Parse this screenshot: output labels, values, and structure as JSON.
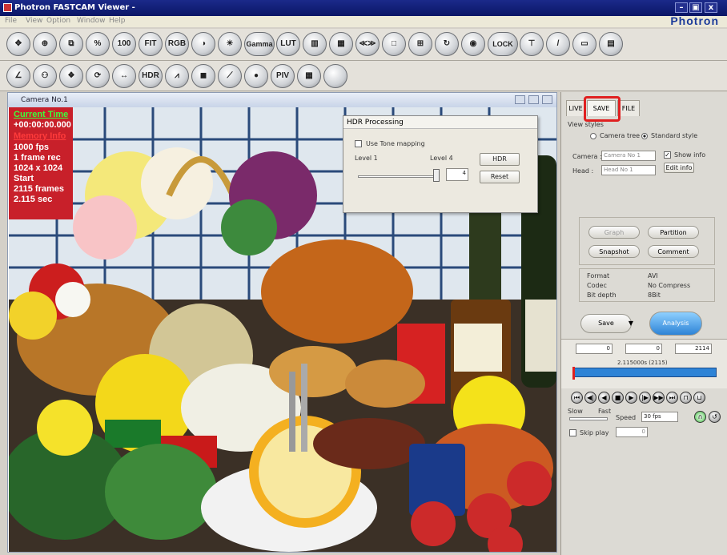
{
  "window": {
    "title": "Photron FASTCAM Viewer -",
    "minimize": "–",
    "restore": "▣",
    "close": "x",
    "brand": "Photron"
  },
  "menu": [
    "File",
    "View",
    "Option",
    "Window",
    "Help"
  ],
  "toolbar1": [
    {
      "name": "move-icon",
      "label": "✥"
    },
    {
      "name": "zoom-in-icon",
      "label": "⊕"
    },
    {
      "name": "crop-icon",
      "label": "⧉"
    },
    {
      "name": "percent-icon",
      "label": "%"
    },
    {
      "name": "zoom-100-icon",
      "label": "100"
    },
    {
      "name": "fit-icon",
      "label": "FIT"
    },
    {
      "name": "rgb-icon",
      "label": "RGB"
    },
    {
      "name": "contrast-icon",
      "label": "◑"
    },
    {
      "name": "brightness-icon",
      "label": "☀"
    },
    {
      "name": "gamma-icon",
      "label": "Gamma"
    },
    {
      "name": "lut-reset-icon",
      "label": "LUT"
    },
    {
      "name": "color-bars-icon",
      "label": "▥"
    },
    {
      "name": "color-reset-icon",
      "label": "▦"
    },
    {
      "name": "shading-icon",
      "label": "≪≫"
    },
    {
      "name": "frame-icon",
      "label": "□"
    },
    {
      "name": "grid-icon",
      "label": "⊞"
    },
    {
      "name": "refresh-icon",
      "label": "↻"
    },
    {
      "name": "target-icon",
      "label": "◉"
    },
    {
      "name": "multi-lock-icon",
      "label": "LOCK"
    },
    {
      "name": "trigger-icon",
      "label": "⊤"
    },
    {
      "name": "pen-icon",
      "label": "/"
    },
    {
      "name": "keyboard-icon",
      "label": "▭"
    },
    {
      "name": "record-icon",
      "label": "▤"
    }
  ],
  "toolbar2": [
    {
      "name": "angle-icon",
      "label": "∠"
    },
    {
      "name": "people-icon",
      "label": "⚇"
    },
    {
      "name": "track-icon",
      "label": "❖"
    },
    {
      "name": "rotate-icon",
      "label": "⟳"
    },
    {
      "name": "measure-icon",
      "label": "↔"
    },
    {
      "name": "hdr-icon",
      "label": "HDR"
    },
    {
      "name": "graph-icon",
      "label": "⩘"
    },
    {
      "name": "camera-icon",
      "label": "◼"
    },
    {
      "name": "line-icon",
      "label": "⟋"
    },
    {
      "name": "point-icon",
      "label": "●"
    },
    {
      "name": "piv-icon",
      "label": "PIV"
    },
    {
      "name": "grid-view-icon",
      "label": "▦"
    },
    {
      "name": "blank-icon",
      "label": ""
    }
  ],
  "camera": {
    "title": "Camera No.1",
    "overlay": [
      "Current Time",
      "+00:00:00.000",
      "Memory Info",
      "1000 fps",
      "1 frame rec",
      "1024 x 1024",
      "Start",
      "2115 frames",
      "2.115 sec"
    ]
  },
  "hdr": {
    "title": "HDR Processing",
    "tone_mapping": "Use Tone mapping",
    "level_min": "Level 1",
    "level_max": "Level 4",
    "level_value": "4",
    "hdr_button": "HDR",
    "reset_button": "Reset"
  },
  "panel": {
    "tabs": [
      "LIVE",
      "SAVE",
      "FILE"
    ],
    "view_styles": "View styles",
    "camera_tree": "Camera tree",
    "standard_style": "Standard style",
    "camera_label": "Camera :",
    "camera_value": "Camera No 1",
    "head_label": "Head :",
    "head_value": "Head No 1",
    "show_info": "Show info",
    "edit_info": "Edit info",
    "graph": "Graph",
    "partition": "Partition",
    "snapshot": "Snapshot",
    "comment": "Comment",
    "format_label": "Format",
    "format_value": "AVI",
    "codec_label": "Codec",
    "codec_value": "No Compress",
    "bitdepth_label": "Bit depth",
    "bitdepth_value": "8Bit",
    "save": "Save",
    "analysis": "Analysis",
    "start": "0",
    "current": "0",
    "end": "2114",
    "timeline": "2.115000s (2115)",
    "slow": "Slow",
    "fast": "Fast",
    "speed_label": "Speed",
    "speed_value": "30 fps",
    "skip_play": "Skip play",
    "skip_value": "0"
  },
  "colors": {
    "accent": "#2d83d6",
    "highlight": "#e02020"
  }
}
